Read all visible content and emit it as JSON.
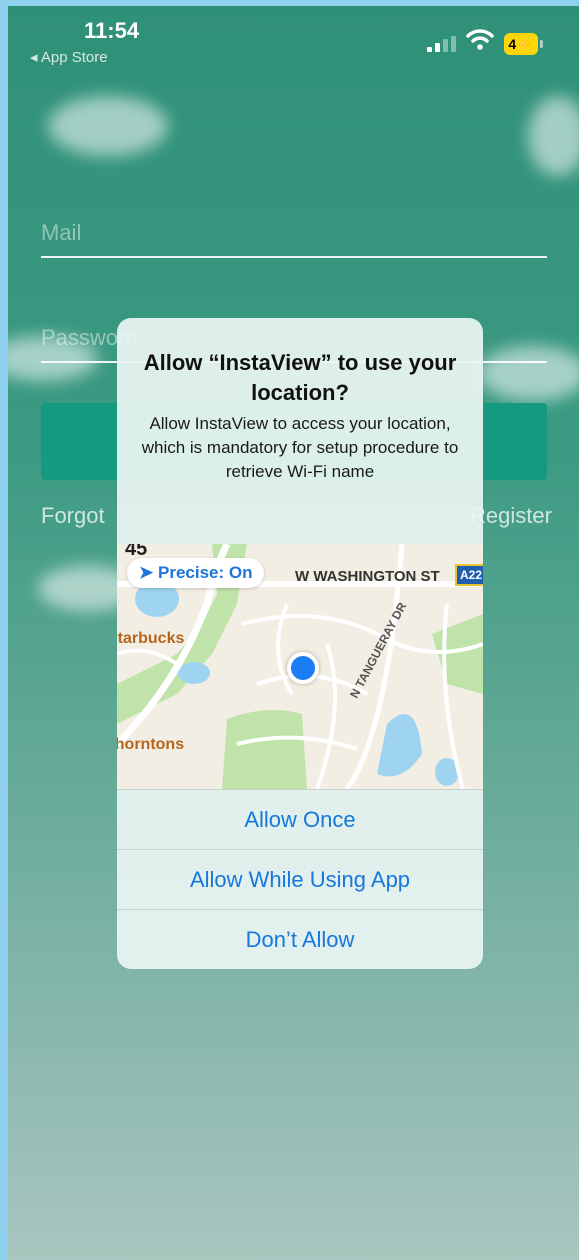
{
  "status_bar": {
    "time": "11:54",
    "back_app": "◂ App Store",
    "battery": "4⚡"
  },
  "login": {
    "mail_placeholder": "Mail",
    "password_placeholder": "Password",
    "forgot_label": "Forgot",
    "register_label": "Register"
  },
  "dialog": {
    "title": "Allow “InstaView” to use your location?",
    "message": "Allow InstaView to access your location, which is mandatory for setup procedure to retrieve Wi-Fi name",
    "precise_label": "Precise: On",
    "map_labels": {
      "street_1": "W WASHINGTON ST",
      "street_2": "N TANGUERAY DR",
      "poi_1": "Starbucks",
      "poi_2": "Thorntons",
      "route_1": "45",
      "route_2": "A22"
    },
    "actions": [
      "Allow Once",
      "Allow While Using App",
      "Don’t Allow"
    ]
  },
  "colors": {
    "accent": "#1678dc",
    "button": "#159980",
    "battery": "#ffd60a"
  }
}
